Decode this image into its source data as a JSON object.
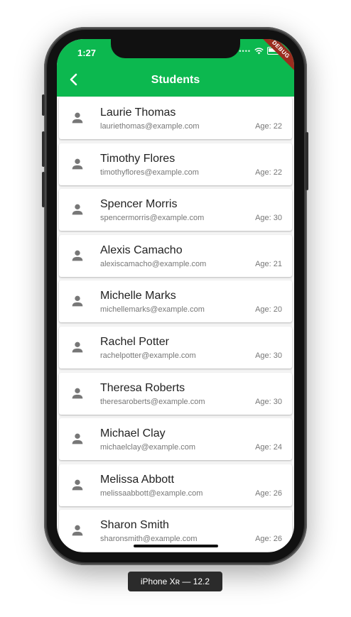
{
  "status_bar": {
    "time": "1:27",
    "debug_label": "DEBUG"
  },
  "appbar": {
    "title": "Students",
    "back_icon": "chevron-left-icon"
  },
  "accent_color": "#0cb84f",
  "students": [
    {
      "name": "Laurie Thomas",
      "email": "lauriethomas@example.com",
      "age": "Age: 22"
    },
    {
      "name": "Timothy Flores",
      "email": "timothyflores@example.com",
      "age": "Age: 22"
    },
    {
      "name": "Spencer Morris",
      "email": "spencermorris@example.com",
      "age": "Age: 30"
    },
    {
      "name": "Alexis Camacho",
      "email": "alexiscamacho@example.com",
      "age": "Age: 21"
    },
    {
      "name": "Michelle Marks",
      "email": "michellemarks@example.com",
      "age": "Age: 20"
    },
    {
      "name": "Rachel Potter",
      "email": "rachelpotter@example.com",
      "age": "Age: 30"
    },
    {
      "name": "Theresa Roberts",
      "email": "theresaroberts@example.com",
      "age": "Age: 30"
    },
    {
      "name": "Michael Clay",
      "email": "michaelclay@example.com",
      "age": "Age: 24"
    },
    {
      "name": "Melissa Abbott",
      "email": "melissaabbott@example.com",
      "age": "Age: 26"
    },
    {
      "name": "Sharon Smith",
      "email": "sharonsmith@example.com",
      "age": "Age: 26"
    }
  ],
  "device_label": "iPhone Xʀ — 12.2"
}
